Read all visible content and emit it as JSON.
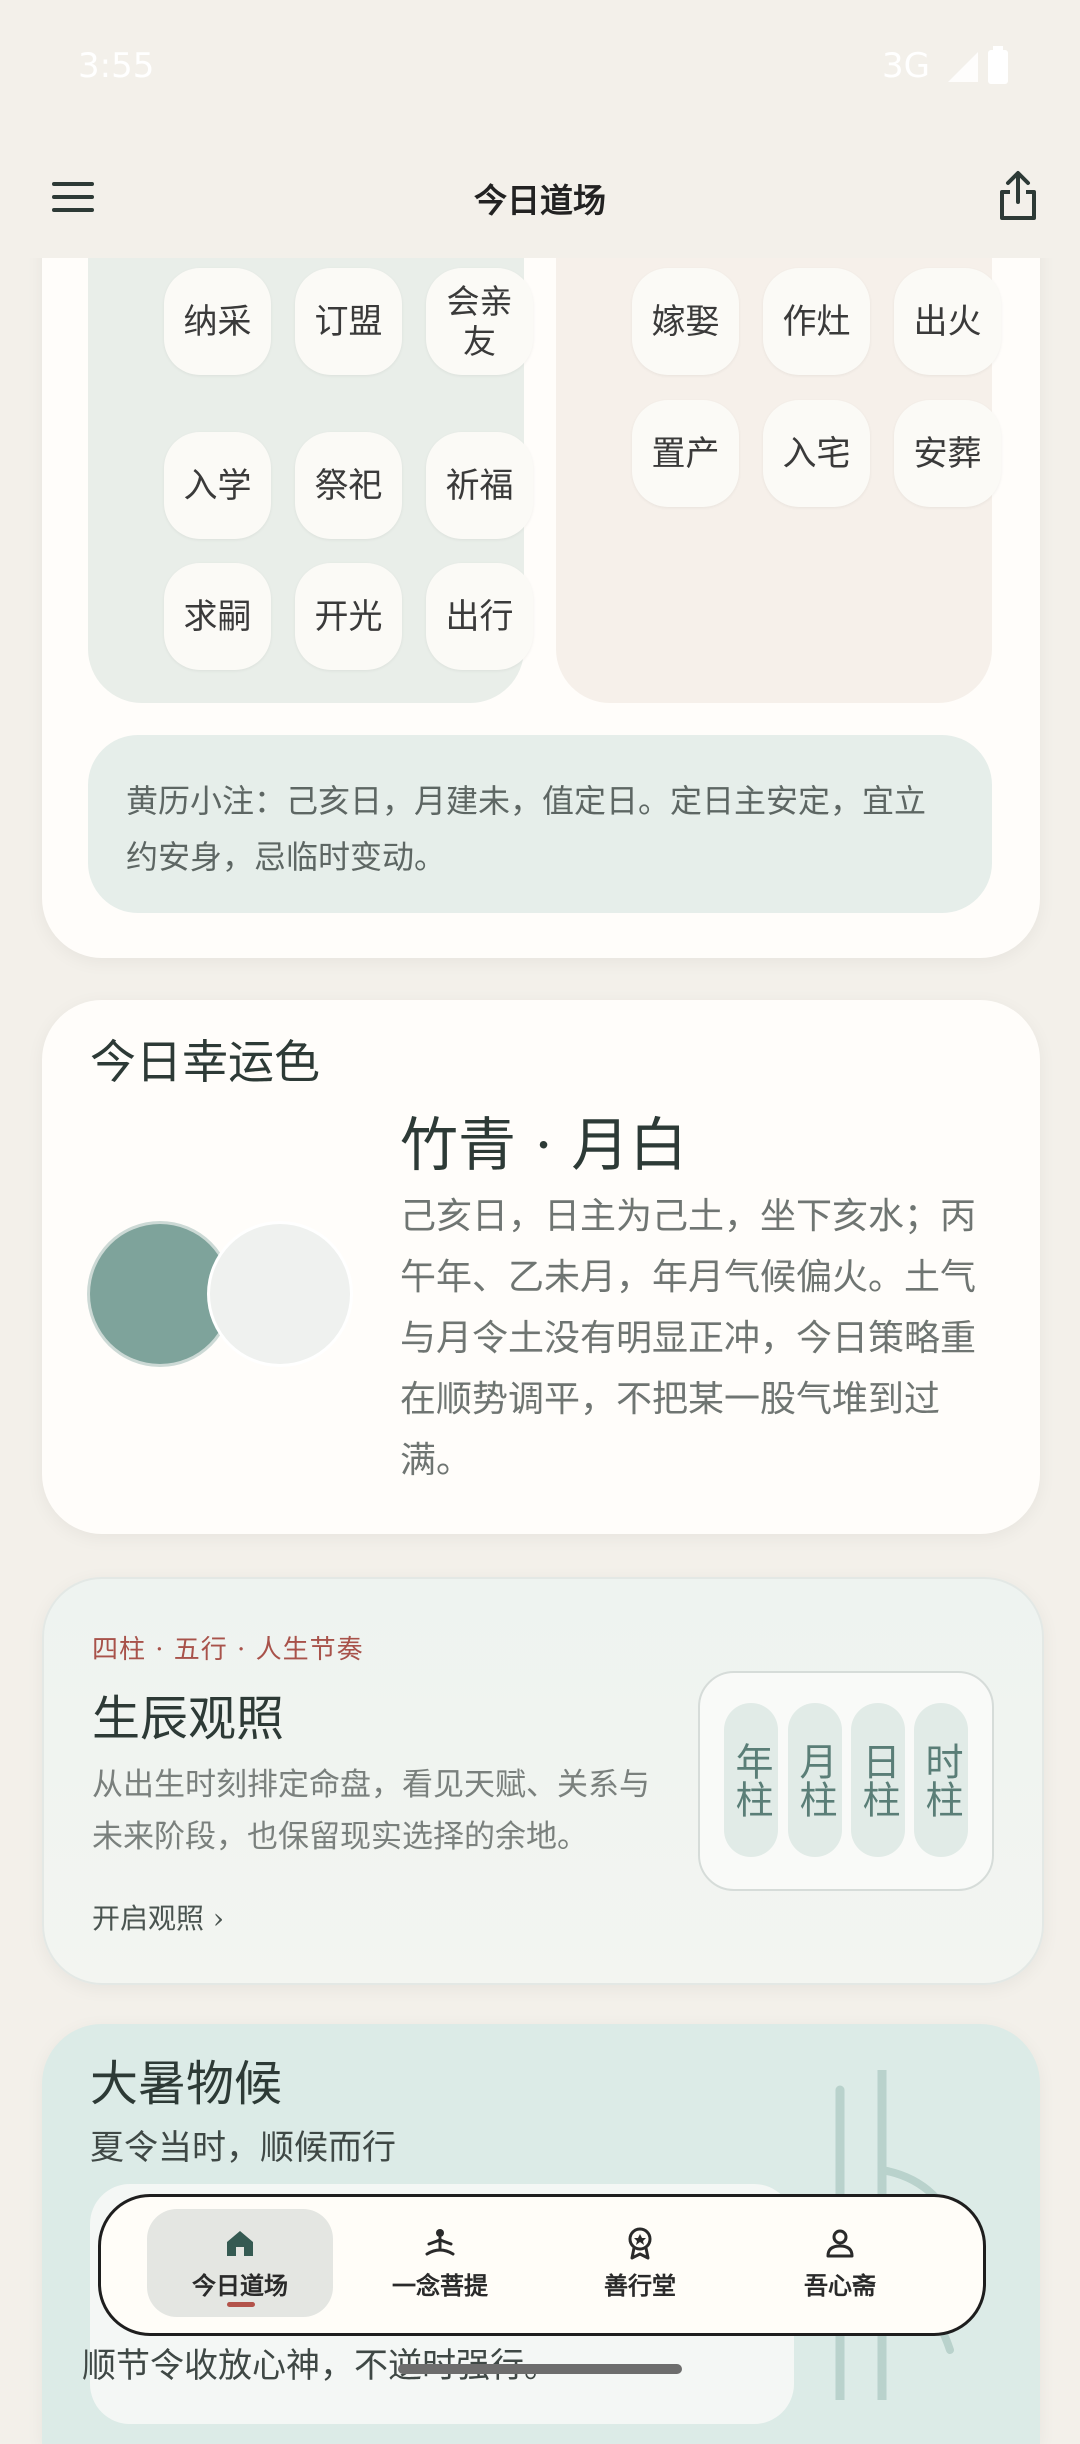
{
  "status": {
    "time": "3:55",
    "network": "3G"
  },
  "app_bar": {
    "title": "今日道场"
  },
  "yi_chips": [
    {
      "label": "纳采"
    },
    {
      "label": "订盟"
    },
    {
      "label": "会亲友"
    },
    {
      "label": "入学"
    },
    {
      "label": "祭祀"
    },
    {
      "label": "祈福"
    },
    {
      "label": "求嗣"
    },
    {
      "label": "开光"
    },
    {
      "label": "出行"
    }
  ],
  "ji_chips": [
    {
      "label": "嫁娶"
    },
    {
      "label": "作灶"
    },
    {
      "label": "出火"
    },
    {
      "label": "置产"
    },
    {
      "label": "入宅"
    },
    {
      "label": "安葬"
    }
  ],
  "almanac_note": "黄历小注：己亥日，月建未，值定日。定日主安定，宜立约安身，忌临时变动。",
  "lucky_color": {
    "title": "今日幸运色",
    "name": "竹青 · 月白",
    "description": "己亥日，日主为己土，坐下亥水；丙午年、乙未月，年月气候偏火。土气与月令土没有明显正冲，今日策略重在顺势调平，不把某一股气堆到过满。",
    "colors": [
      "#7ea39b",
      "#eff1ef"
    ]
  },
  "birth_chart": {
    "kicker": "四柱 · 五行 · 人生节奏",
    "title": "生辰观照",
    "description": "从出生时刻排定命盘，看见天赋、关系与未来阶段，也保留现实选择的余地。",
    "link": "开启观照 ›",
    "pillars": [
      "年柱",
      "月柱",
      "日柱",
      "时柱"
    ]
  },
  "season": {
    "title": "大暑物候",
    "subtitle": "夏令当时，顺候而行",
    "text": "顺节令收放心神，不逆时强行。"
  },
  "bottom_nav": [
    {
      "label": "今日道场",
      "icon": "home-icon",
      "active": true
    },
    {
      "label": "一念菩提",
      "icon": "meditation-icon",
      "active": false
    },
    {
      "label": "善行堂",
      "icon": "badge-icon",
      "active": false
    },
    {
      "label": "吾心斋",
      "icon": "person-icon",
      "active": false
    }
  ]
}
